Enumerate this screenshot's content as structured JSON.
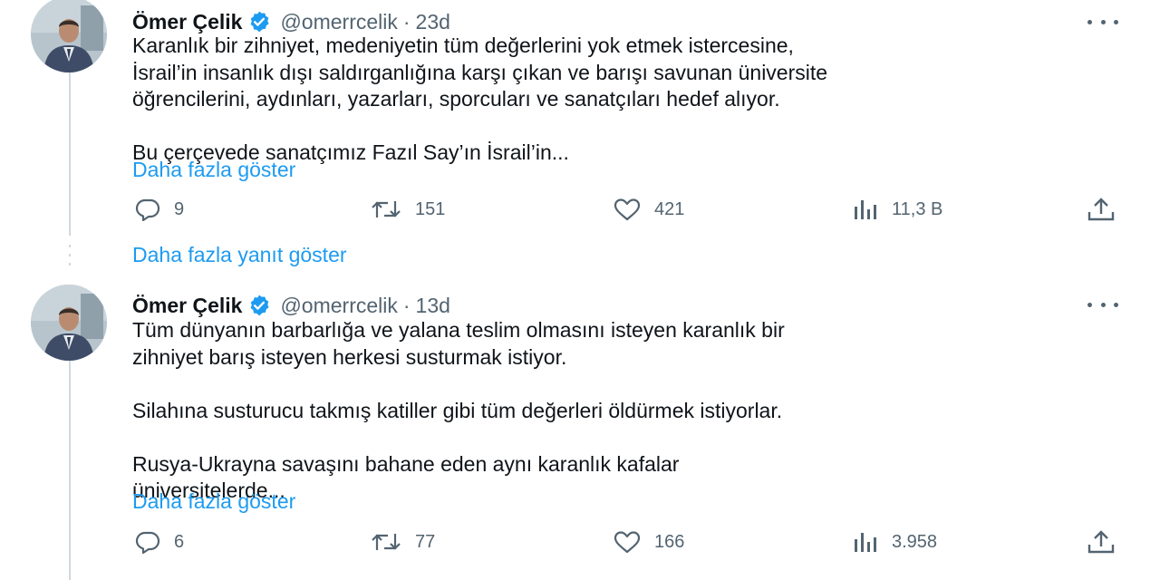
{
  "tweets": [
    {
      "author_name": "Ömer Çelik",
      "handle": "@omerrcelik",
      "separator": "·",
      "time": "23d",
      "paragraphs": [
        "Karanlık bir zihniyet, medeniyetin tüm değerlerini yok etmek istercesine,\nİsrail’in insanlık dışı saldırganlığına karşı çıkan ve barışı savunan üniversite\nöğrencilerini, aydınları, yazarları, sporcuları  ve sanatçıları hedef alıyor.",
        "Bu çerçevede sanatçımız Fazıl Say’ın İsrail’in..."
      ],
      "show_more": "Daha fazla göster",
      "replies": "9",
      "reposts": "151",
      "likes": "421",
      "views": "11,3 B"
    },
    {
      "author_name": "Ömer Çelik",
      "handle": "@omerrcelik",
      "separator": "·",
      "time": "13d",
      "paragraphs": [
        "Tüm dünyanın barbarlığa ve yalana teslim olmasını isteyen karanlık bir\nzihniyet barış isteyen herkesi susturmak istiyor.",
        "Silahına susturucu takmış katiller gibi tüm değerleri öldürmek istiyorlar.",
        "Rusya-Ukrayna savaşını bahane eden aynı karanlık kafalar\nüniversitelerde..."
      ],
      "show_more": "Daha fazla göster",
      "replies": "6",
      "reposts": "77",
      "likes": "166",
      "views": "3.958"
    }
  ],
  "thread": {
    "more_replies": "Daha fazla yanıt göster"
  },
  "icons": {
    "verified": "verified-badge-icon",
    "more": "more-options-icon",
    "reply": "reply-icon",
    "repost": "repost-icon",
    "like": "heart-icon",
    "views": "views-chart-icon",
    "share": "share-icon"
  },
  "colors": {
    "link": "#1d9bf0",
    "secondary_text": "#536471",
    "primary_text": "#0f1419",
    "thread_line": "#cfd9de",
    "verified": "#1d9bf0"
  }
}
